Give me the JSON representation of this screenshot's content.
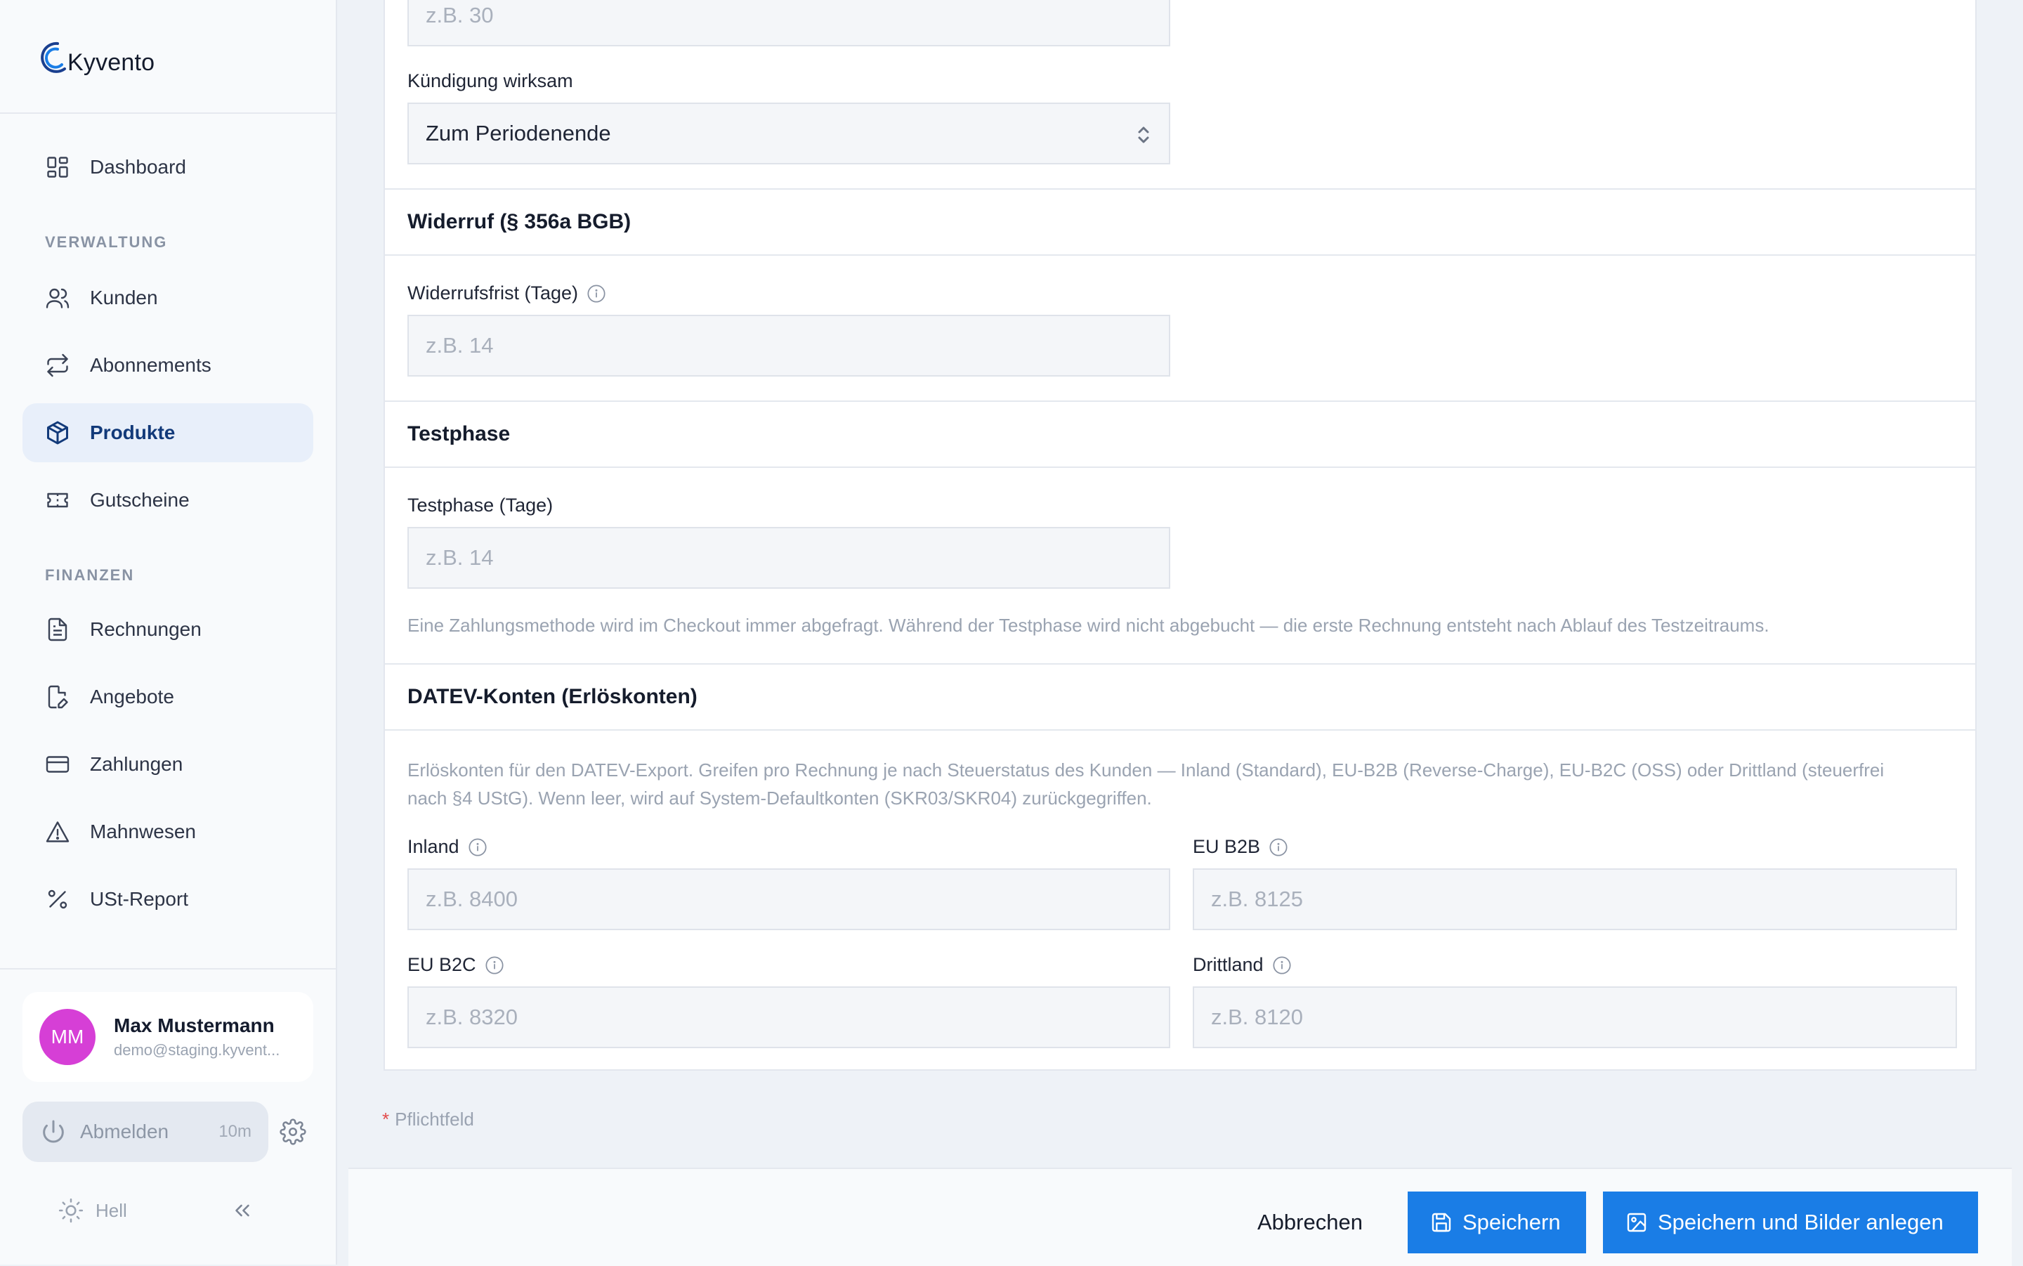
{
  "brand": {
    "name": "Kyvento"
  },
  "sidebar": {
    "dashboard": "Dashboard",
    "section_verwaltung": "VERWALTUNG",
    "section_finanzen": "FINANZEN",
    "items": [
      {
        "label": "Kunden"
      },
      {
        "label": "Abonnements"
      },
      {
        "label": "Produkte"
      },
      {
        "label": "Gutscheine"
      },
      {
        "label": "Rechnungen"
      },
      {
        "label": "Angebote"
      },
      {
        "label": "Zahlungen"
      },
      {
        "label": "Mahnwesen"
      },
      {
        "label": "USt-Report"
      }
    ],
    "active_item": "Produkte"
  },
  "user": {
    "initials": "MM",
    "name": "Max Mustermann",
    "email": "demo@staging.kyvent..."
  },
  "session": {
    "logout_label": "Abmelden",
    "timer": "10m"
  },
  "theme": {
    "label": "Hell"
  },
  "form": {
    "top_input_placeholder": "z.B. 30",
    "kuendigung": {
      "label": "Kündigung wirksam",
      "value": "Zum Periodenende"
    },
    "widerruf": {
      "title": "Widerruf (§ 356a BGB)",
      "label": "Widerrufsfrist (Tage)",
      "placeholder": "z.B. 14"
    },
    "testphase": {
      "title": "Testphase",
      "label": "Testphase (Tage)",
      "placeholder": "z.B. 14",
      "hint": "Eine Zahlungsmethode wird im Checkout immer abgefragt. Während der Testphase wird nicht abgebucht — die erste Rechnung entsteht nach Ablauf des Testzeitraums."
    },
    "datev": {
      "title": "DATEV-Konten (Erlöskonten)",
      "hint_line1": "Erlöskonten für den DATEV-Export. Greifen pro Rechnung je nach Steuerstatus des Kunden — Inland (Standard), EU-B2B (Reverse-Charge), EU-B2C (OSS) oder Drittland (steuerfrei",
      "hint_line2": "nach §4 UStG). Wenn leer, wird auf System-Defaultkonten (SKR03/SKR04) zurückgegriffen.",
      "inland": {
        "label": "Inland",
        "placeholder": "z.B. 8400"
      },
      "eu_b2b": {
        "label": "EU B2B",
        "placeholder": "z.B. 8125"
      },
      "eu_b2c": {
        "label": "EU B2C",
        "placeholder": "z.B. 8320"
      },
      "drittland": {
        "label": "Drittland",
        "placeholder": "z.B. 8120"
      }
    },
    "required_note": "Pflichtfeld"
  },
  "footer": {
    "cancel": "Abbrechen",
    "save": "Speichern",
    "save_images": "Speichern und Bilder anlegen"
  },
  "colors": {
    "accent": "#1a7de6",
    "active_nav_bg": "#e8effa",
    "avatar": "#d63fd6"
  }
}
